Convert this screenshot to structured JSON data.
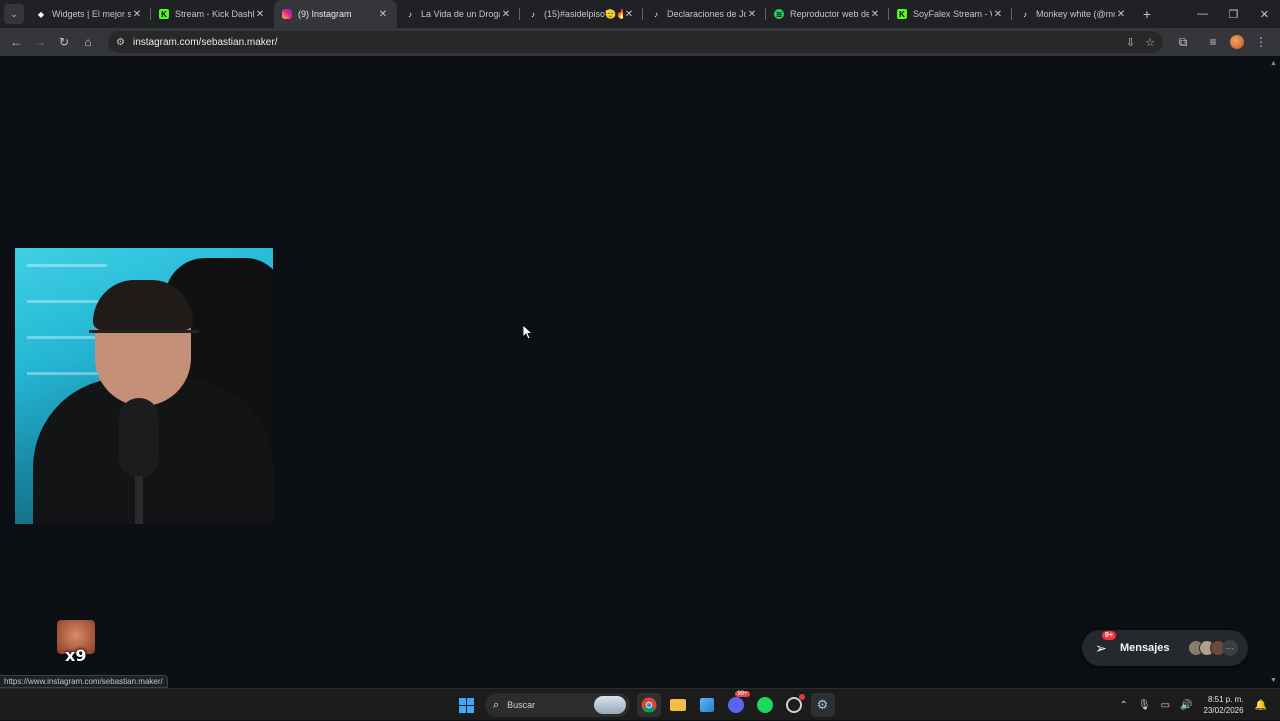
{
  "browser": {
    "tabs": [
      {
        "title": "Widgets | El mejor so",
        "favicon": "widgets-icon",
        "active": false
      },
      {
        "title": "Stream - Kick Dashbo",
        "favicon": "kick-icon",
        "active": false
      },
      {
        "title": "(9) Instagram",
        "favicon": "instagram-icon",
        "active": true
      },
      {
        "title": "La Vida de un Drogad",
        "favicon": "tiktok-icon",
        "active": false
      },
      {
        "title": "(15)#asidelpiso🫡🔥",
        "favicon": "tiktok-icon",
        "active": false
      },
      {
        "title": "Declaraciones de Jos",
        "favicon": "tiktok-icon",
        "active": false
      },
      {
        "title": "Reproductor web de",
        "favicon": "spotify-icon",
        "active": false
      },
      {
        "title": "SoyFalex Stream - W",
        "favicon": "kick-icon",
        "active": false
      },
      {
        "title": "Monkey white (@mo",
        "favicon": "tiktok-icon",
        "active": false
      }
    ],
    "url": "instagram.com/sebastian.maker/",
    "status_url": "https://www.instagram.com/sebastian.maker/"
  },
  "page": {
    "messages": {
      "label": "Mensajes",
      "badge": "9+"
    },
    "emote": {
      "count": "x9"
    }
  },
  "taskbar": {
    "search_placeholder": "Buscar",
    "notification_badge": "99+",
    "time": "8:51 p. m.",
    "date": "23/02/2026"
  },
  "colors": {
    "page_bg": "#0c1014",
    "instagram_badge": "#ff3040",
    "tab_strip": "#202124",
    "toolbar": "#35363a"
  }
}
